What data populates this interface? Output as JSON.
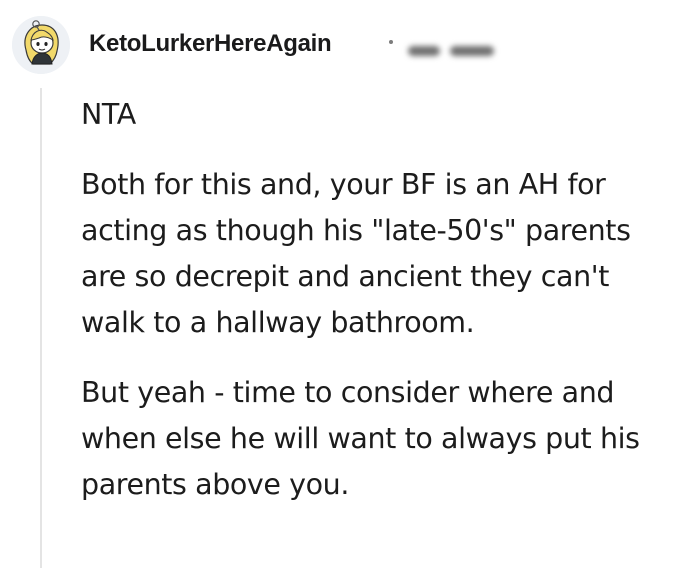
{
  "comment": {
    "author": {
      "username": "KetoLurkerHereAgain",
      "avatar": "snoo-avatar-blonde"
    },
    "paragraphs": [
      [
        "NTA"
      ],
      [
        "Both for this and, your BF is an AH for",
        "acting as though his \"late-50's\" parents",
        "are so decrepit and ancient they can't",
        "walk to a hallway bathroom."
      ],
      [
        "But yeah - time to consider where and",
        "when else he will want to always put his",
        "parents above you."
      ]
    ]
  },
  "colors": {
    "text": "#1c1c1c",
    "thread_line": "#e4e4e4",
    "meta": "#7c7c7c"
  }
}
